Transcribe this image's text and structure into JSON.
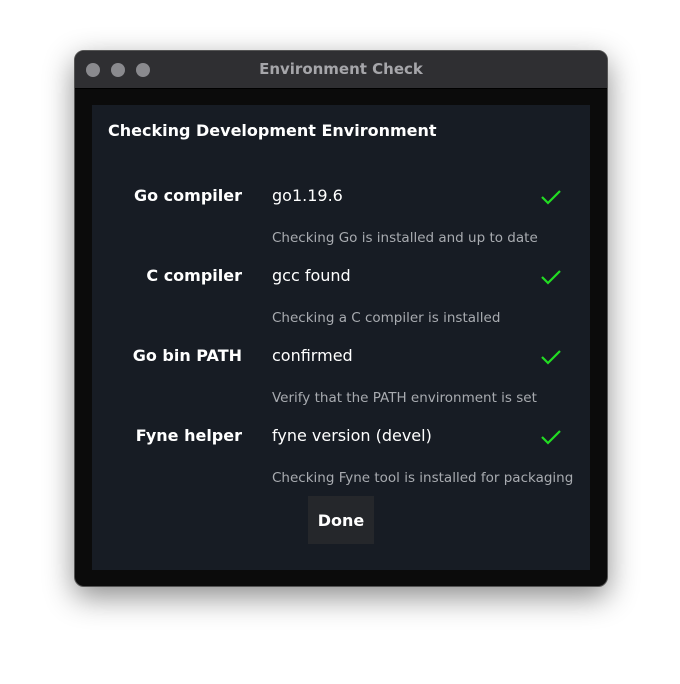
{
  "window": {
    "title": "Environment Check"
  },
  "heading": "Checking Development Environment",
  "checks": [
    {
      "label": "Go compiler",
      "value": "go1.19.6",
      "description": "Checking Go is installed and up to date",
      "status": "ok"
    },
    {
      "label": "C compiler",
      "value": "gcc found",
      "description": "Checking a C compiler is installed",
      "status": "ok"
    },
    {
      "label": "Go bin PATH",
      "value": "confirmed",
      "description": "Verify that the PATH environment is set",
      "status": "ok"
    },
    {
      "label": "Fyne helper",
      "value": "fyne version (devel)",
      "description": "Checking Fyne tool is installed for packaging",
      "status": "ok"
    }
  ],
  "done_label": "Done",
  "colors": {
    "check": "#22dd22",
    "panel": "#171c24"
  }
}
